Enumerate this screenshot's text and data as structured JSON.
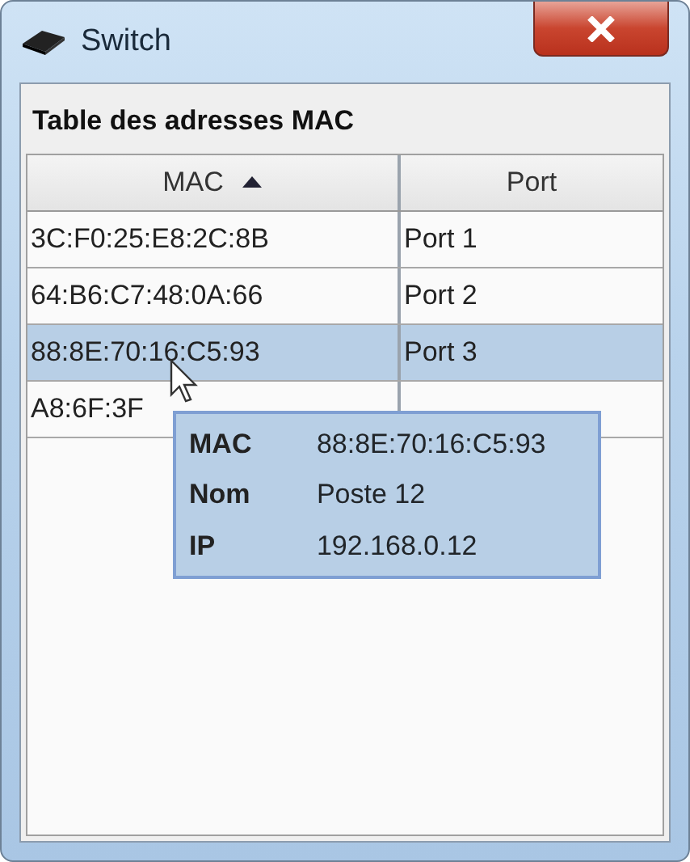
{
  "window": {
    "title": "Switch"
  },
  "panel": {
    "title": "Table des adresses MAC"
  },
  "table": {
    "columns": [
      {
        "label": "MAC",
        "sorted": true
      },
      {
        "label": "Port",
        "sorted": false
      }
    ],
    "rows": [
      {
        "mac": "3C:F0:25:E8:2C:8B",
        "port": "Port 1",
        "selected": false
      },
      {
        "mac": "64:B6:C7:48:0A:66",
        "port": "Port 2",
        "selected": false
      },
      {
        "mac": "88:8E:70:16:C5:93",
        "port": "Port 3",
        "selected": true
      },
      {
        "mac": "A8:6F:3F",
        "selected": false
      }
    ]
  },
  "tooltip": {
    "rows": [
      {
        "label": "MAC",
        "value": "88:8E:70:16:C5:93"
      },
      {
        "label": "Nom",
        "value": "Poste 12"
      },
      {
        "label": "IP",
        "value": "192.168.0.12"
      }
    ]
  }
}
